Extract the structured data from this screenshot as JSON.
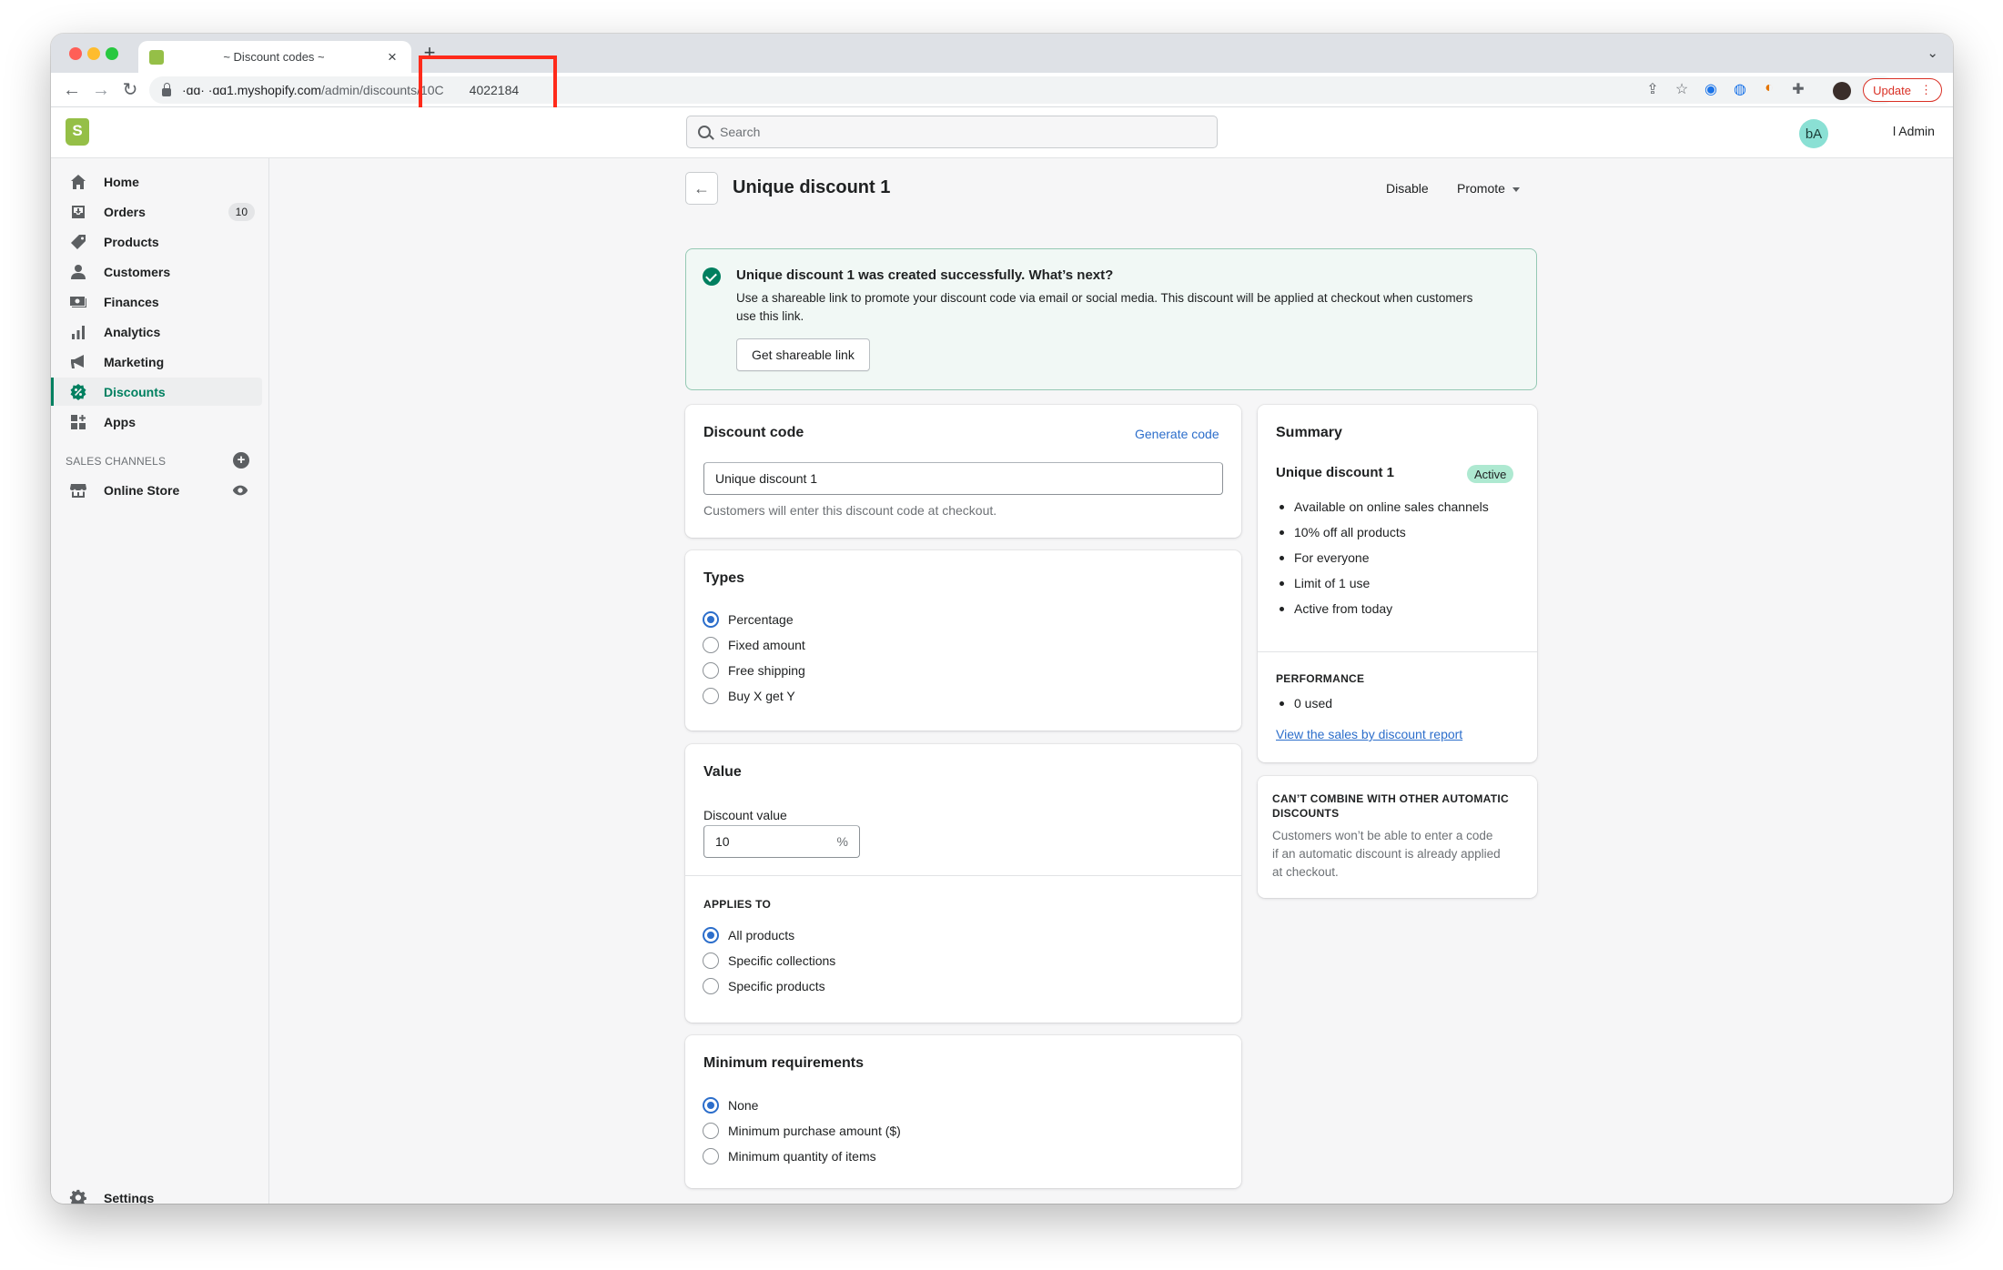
{
  "browser": {
    "tab_title": "~ Discount codes ~",
    "url_host": "·ɑɑ·  ·ɑɑ1.myshopify.com",
    "url_path": "/admin/discounts/10C",
    "url_id": "4022184",
    "update_label": "Update",
    "update_menu": "⋮",
    "new_tab": "+",
    "close_tab": "×"
  },
  "appbar": {
    "search_placeholder": "Search",
    "avatar_initials": "bA",
    "user_name": "l Admin"
  },
  "sidebar": {
    "items": [
      {
        "label": "Home",
        "icon": "home-icon"
      },
      {
        "label": "Orders",
        "icon": "orders-icon",
        "badge": "10"
      },
      {
        "label": "Products",
        "icon": "products-icon"
      },
      {
        "label": "Customers",
        "icon": "customers-icon"
      },
      {
        "label": "Finances",
        "icon": "finances-icon"
      },
      {
        "label": "Analytics",
        "icon": "analytics-icon"
      },
      {
        "label": "Marketing",
        "icon": "marketing-icon"
      },
      {
        "label": "Discounts",
        "icon": "discounts-icon",
        "active": true
      },
      {
        "label": "Apps",
        "icon": "apps-icon"
      }
    ],
    "channels_heading": "SALES CHANNELS",
    "online_store": "Online Store",
    "settings": "Settings"
  },
  "page": {
    "title": "Unique discount 1",
    "disable_label": "Disable",
    "promote_label": "Promote"
  },
  "banner": {
    "title": "Unique discount 1 was created successfully. What’s next?",
    "text": "Use a shareable link to promote your discount code via email or social media. This discount will be applied at checkout when customers use this link.",
    "button": "Get shareable link"
  },
  "discount_code": {
    "title": "Discount code",
    "generate_link": "Generate code",
    "value": "Unique discount 1",
    "help": "Customers will enter this discount code at checkout."
  },
  "types": {
    "title": "Types",
    "options": [
      "Percentage",
      "Fixed amount",
      "Free shipping",
      "Buy X get Y"
    ],
    "selected": "Percentage"
  },
  "value_card": {
    "title": "Value",
    "field_label": "Discount value",
    "value": "10",
    "suffix": "%",
    "applies_heading": "APPLIES TO",
    "applies_options": [
      "All products",
      "Specific collections",
      "Specific products"
    ],
    "applies_selected": "All products"
  },
  "minimum": {
    "title": "Minimum requirements",
    "options": [
      "None",
      "Minimum purchase amount ($)",
      "Minimum quantity of items"
    ],
    "selected": "None"
  },
  "summary": {
    "title": "Summary",
    "discount_name": "Unique discount 1",
    "status": "Active",
    "details": [
      "Available on online sales channels",
      "10% off all products",
      "For everyone",
      "Limit of 1 use",
      "Active from today"
    ],
    "performance_heading": "PERFORMANCE",
    "performance_items": [
      "0 used"
    ],
    "report_link": "View the sales by discount report"
  },
  "combine": {
    "heading_line1": "CAN’T COMBINE WITH OTHER AUTOMATIC",
    "heading_line2": "DISCOUNTS",
    "text_line1": "Customers won’t be able to enter a code",
    "text_line2": "if an automatic discount is already applied",
    "text_line3": "at checkout."
  },
  "colors": {
    "brand": "#95bf47",
    "accent_green": "#008060",
    "link_blue": "#2c6ecb",
    "highlight_red": "#ff2a1a"
  }
}
